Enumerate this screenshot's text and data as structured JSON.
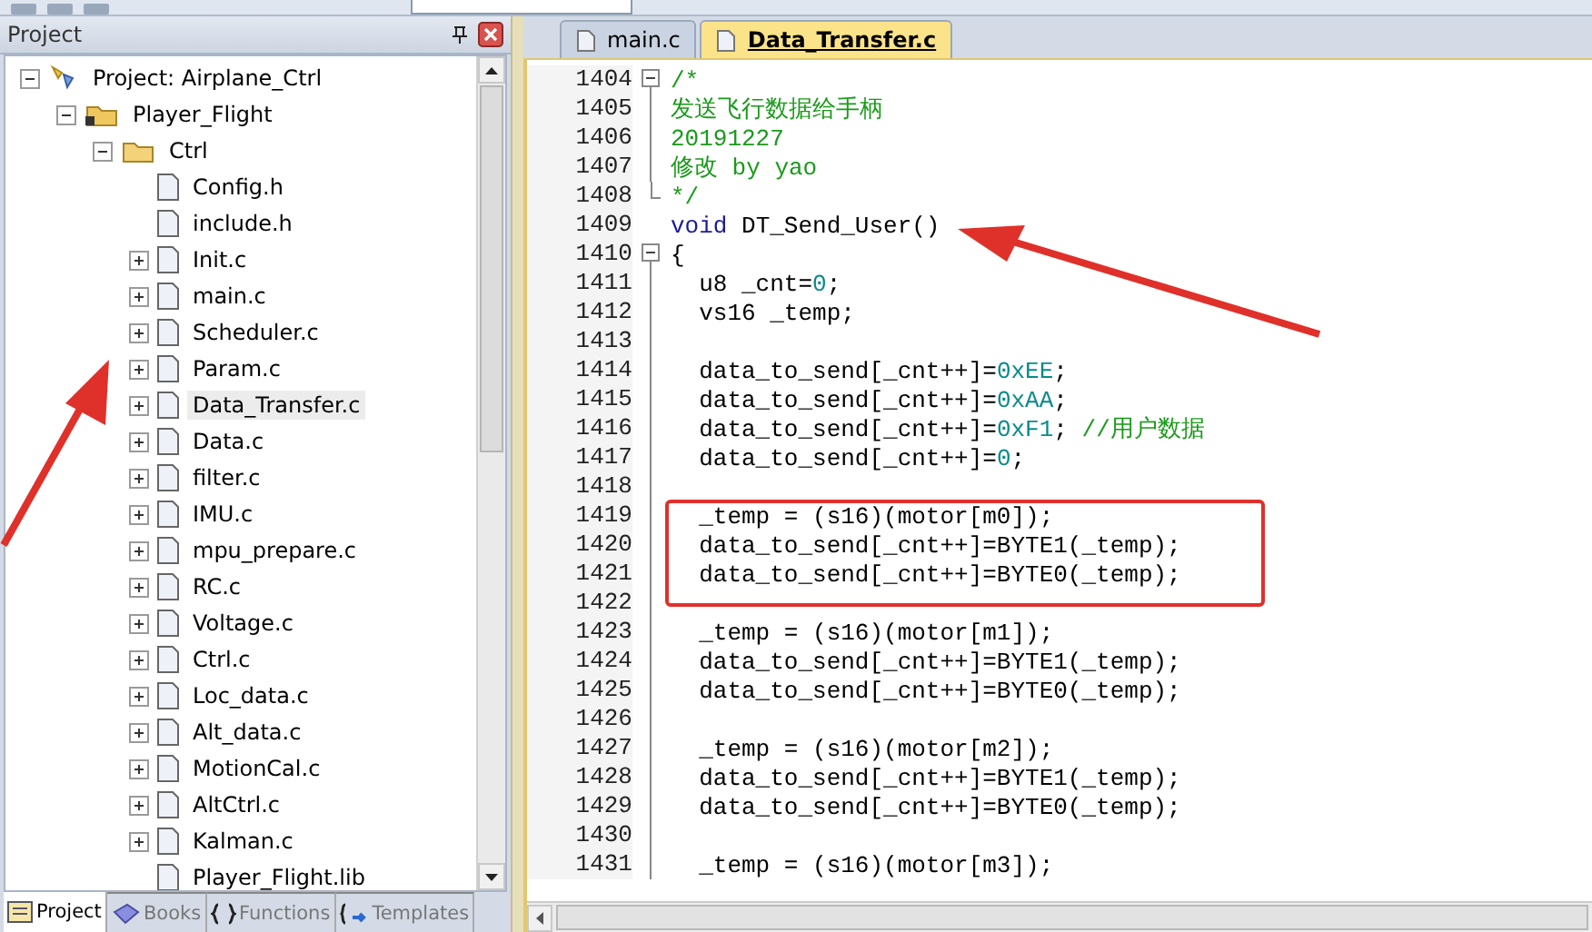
{
  "project_panel": {
    "title": "Project",
    "tree": [
      {
        "label": "Project: Airplane_Ctrl",
        "kind": "project",
        "expanded": true,
        "selected": false,
        "children": [
          {
            "label": "Player_Flight",
            "kind": "group",
            "expanded": true,
            "selected": false,
            "children": [
              {
                "label": "Ctrl",
                "kind": "folder",
                "expanded": true,
                "selected": false,
                "children": [
                  {
                    "label": "Config.h",
                    "kind": "file",
                    "selected": false
                  },
                  {
                    "label": "include.h",
                    "kind": "file",
                    "selected": false
                  },
                  {
                    "label": "Init.c",
                    "kind": "file",
                    "expanded": false,
                    "selected": false
                  },
                  {
                    "label": "main.c",
                    "kind": "file",
                    "expanded": false,
                    "selected": false
                  },
                  {
                    "label": "Scheduler.c",
                    "kind": "file",
                    "expanded": false,
                    "selected": false
                  },
                  {
                    "label": "Param.c",
                    "kind": "file",
                    "expanded": false,
                    "selected": false
                  },
                  {
                    "label": "Data_Transfer.c",
                    "kind": "file",
                    "expanded": false,
                    "selected": true
                  },
                  {
                    "label": "Data.c",
                    "kind": "file",
                    "expanded": false,
                    "selected": false
                  },
                  {
                    "label": "filter.c",
                    "kind": "file",
                    "expanded": false,
                    "selected": false
                  },
                  {
                    "label": "IMU.c",
                    "kind": "file",
                    "expanded": false,
                    "selected": false
                  },
                  {
                    "label": "mpu_prepare.c",
                    "kind": "file",
                    "expanded": false,
                    "selected": false
                  },
                  {
                    "label": "RC.c",
                    "kind": "file",
                    "expanded": false,
                    "selected": false
                  },
                  {
                    "label": "Voltage.c",
                    "kind": "file",
                    "expanded": false,
                    "selected": false
                  },
                  {
                    "label": "Ctrl.c",
                    "kind": "file",
                    "expanded": false,
                    "selected": false
                  },
                  {
                    "label": "Loc_data.c",
                    "kind": "file",
                    "expanded": false,
                    "selected": false
                  },
                  {
                    "label": "Alt_data.c",
                    "kind": "file",
                    "expanded": false,
                    "selected": false
                  },
                  {
                    "label": "MotionCal.c",
                    "kind": "file",
                    "expanded": false,
                    "selected": false
                  },
                  {
                    "label": "AltCtrl.c",
                    "kind": "file",
                    "expanded": false,
                    "selected": false
                  },
                  {
                    "label": "Kalman.c",
                    "kind": "file",
                    "expanded": false,
                    "selected": false
                  },
                  {
                    "label": "Player_Flight.lib",
                    "kind": "file",
                    "selected": false
                  }
                ]
              }
            ]
          }
        ]
      }
    ],
    "bottom_tabs": [
      {
        "label": "Project",
        "kind": "project",
        "selected": true
      },
      {
        "label": "Books",
        "kind": "books",
        "selected": false
      },
      {
        "label": "Functions",
        "kind": "functions",
        "selected": false
      },
      {
        "label": "Templates",
        "kind": "templates",
        "selected": false
      }
    ]
  },
  "editor": {
    "tabs": [
      {
        "label": "main.c",
        "selected": false
      },
      {
        "label": "Data_Transfer.c",
        "selected": true
      }
    ],
    "lines": [
      {
        "number": "1404",
        "kind": "start",
        "tokens": [
          {
            "kind": "comment",
            "text": "/*"
          }
        ]
      },
      {
        "number": "1405",
        "kind": "body",
        "tokens": [
          {
            "kind": "comment",
            "text": "发送飞行数据给手柄"
          }
        ]
      },
      {
        "number": "1406",
        "kind": "body",
        "tokens": [
          {
            "kind": "comment",
            "text": "20191227"
          }
        ]
      },
      {
        "number": "1407",
        "kind": "body",
        "tokens": [
          {
            "kind": "comment",
            "text": "修改 by yao"
          }
        ]
      },
      {
        "number": "1408",
        "kind": "end",
        "tokens": [
          {
            "kind": "comment",
            "text": "*/"
          }
        ]
      },
      {
        "number": "1409",
        "kind": "none",
        "tokens": [
          {
            "kind": "keyword",
            "text": "void"
          },
          {
            "kind": "code",
            "text": " DT_Send_User()"
          }
        ]
      },
      {
        "number": "1410",
        "kind": "start",
        "tokens": [
          {
            "kind": "code",
            "text": "{"
          }
        ]
      },
      {
        "number": "1411",
        "kind": "body",
        "tokens": [
          {
            "kind": "code",
            "text": "  u8 _cnt="
          },
          {
            "kind": "number",
            "text": "0"
          },
          {
            "kind": "code",
            "text": ";"
          }
        ]
      },
      {
        "number": "1412",
        "kind": "body",
        "tokens": [
          {
            "kind": "code",
            "text": "  vs16 _temp;"
          }
        ]
      },
      {
        "number": "1413",
        "kind": "body"
      },
      {
        "number": "1414",
        "kind": "body",
        "tokens": [
          {
            "kind": "code",
            "text": "  data_to_send[_cnt++]="
          },
          {
            "kind": "number",
            "text": "0xEE"
          },
          {
            "kind": "code",
            "text": ";"
          }
        ]
      },
      {
        "number": "1415",
        "kind": "body",
        "tokens": [
          {
            "kind": "code",
            "text": "  data_to_send[_cnt++]="
          },
          {
            "kind": "number",
            "text": "0xAA"
          },
          {
            "kind": "code",
            "text": ";"
          }
        ]
      },
      {
        "number": "1416",
        "kind": "body",
        "tokens": [
          {
            "kind": "code",
            "text": "  data_to_send[_cnt++]="
          },
          {
            "kind": "number",
            "text": "0xF1"
          },
          {
            "kind": "code",
            "text": "; "
          },
          {
            "kind": "comment",
            "text": "//用户数据"
          }
        ]
      },
      {
        "number": "1417",
        "kind": "body",
        "tokens": [
          {
            "kind": "code",
            "text": "  data_to_send[_cnt++]="
          },
          {
            "kind": "number",
            "text": "0"
          },
          {
            "kind": "code",
            "text": ";"
          }
        ]
      },
      {
        "number": "1418",
        "kind": "body"
      },
      {
        "number": "1419",
        "kind": "body",
        "tokens": [
          {
            "kind": "code",
            "text": "  _temp = (s16)(motor[m0]);"
          }
        ]
      },
      {
        "number": "1420",
        "kind": "body",
        "tokens": [
          {
            "kind": "code",
            "text": "  data_to_send[_cnt++]=BYTE1(_temp);"
          }
        ]
      },
      {
        "number": "1421",
        "kind": "body",
        "tokens": [
          {
            "kind": "code",
            "text": "  data_to_send[_cnt++]=BYTE0(_temp);"
          }
        ]
      },
      {
        "number": "1422",
        "kind": "body"
      },
      {
        "number": "1423",
        "kind": "body",
        "tokens": [
          {
            "kind": "code",
            "text": "  _temp = (s16)(motor[m1]);"
          }
        ]
      },
      {
        "number": "1424",
        "kind": "body",
        "tokens": [
          {
            "kind": "code",
            "text": "  data_to_send[_cnt++]=BYTE1(_temp);"
          }
        ]
      },
      {
        "number": "1425",
        "kind": "body",
        "tokens": [
          {
            "kind": "code",
            "text": "  data_to_send[_cnt++]=BYTE0(_temp);"
          }
        ]
      },
      {
        "number": "1426",
        "kind": "body"
      },
      {
        "number": "1427",
        "kind": "body",
        "tokens": [
          {
            "kind": "code",
            "text": "  _temp = (s16)(motor[m2]);"
          }
        ]
      },
      {
        "number": "1428",
        "kind": "body",
        "tokens": [
          {
            "kind": "code",
            "text": "  data_to_send[_cnt++]=BYTE1(_temp);"
          }
        ]
      },
      {
        "number": "1429",
        "kind": "body",
        "tokens": [
          {
            "kind": "code",
            "text": "  data_to_send[_cnt++]=BYTE0(_temp);"
          }
        ]
      },
      {
        "number": "1430",
        "kind": "body"
      },
      {
        "number": "1431",
        "kind": "body",
        "tokens": [
          {
            "kind": "code",
            "text": "  _temp = (s16)(motor[m3]);"
          }
        ]
      }
    ]
  }
}
